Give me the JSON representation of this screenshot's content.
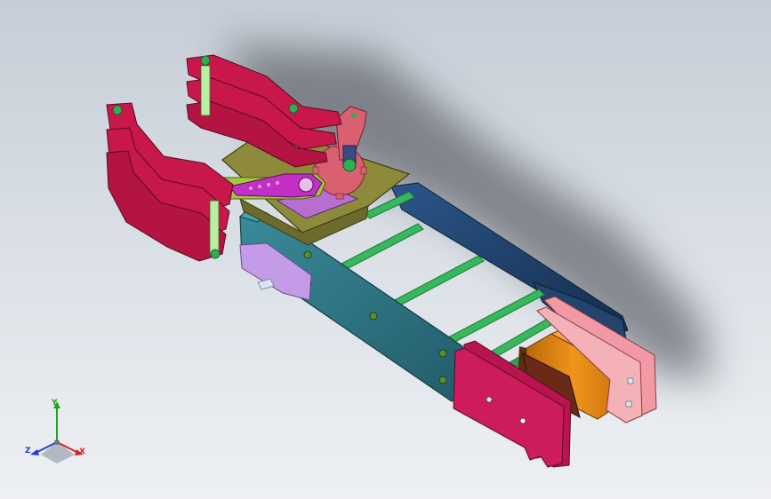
{
  "view": {
    "colors": {
      "background_top": "#c6cdd6",
      "background_bottom": "#eef0f3",
      "crimson_part": "#c8174a",
      "teal_frame": "#2b6e7e",
      "navy_frame": "#1d3d66",
      "green_rods": "#2fae52",
      "orange_motor": "#e58a12",
      "pink_plate": "#f0a0a8",
      "olive_plate": "#8e8a3c",
      "purple_plate": "#b66fd0",
      "magenta_arm": "#c12fc4",
      "lime_arm": "#a6c93a",
      "rose_gear": "#d86070",
      "lilac_base": "#c49be6"
    }
  },
  "triad": {
    "x_label": "X",
    "y_label": "Y",
    "z_label": "Z",
    "icon": "coordinate-triad-icon"
  }
}
